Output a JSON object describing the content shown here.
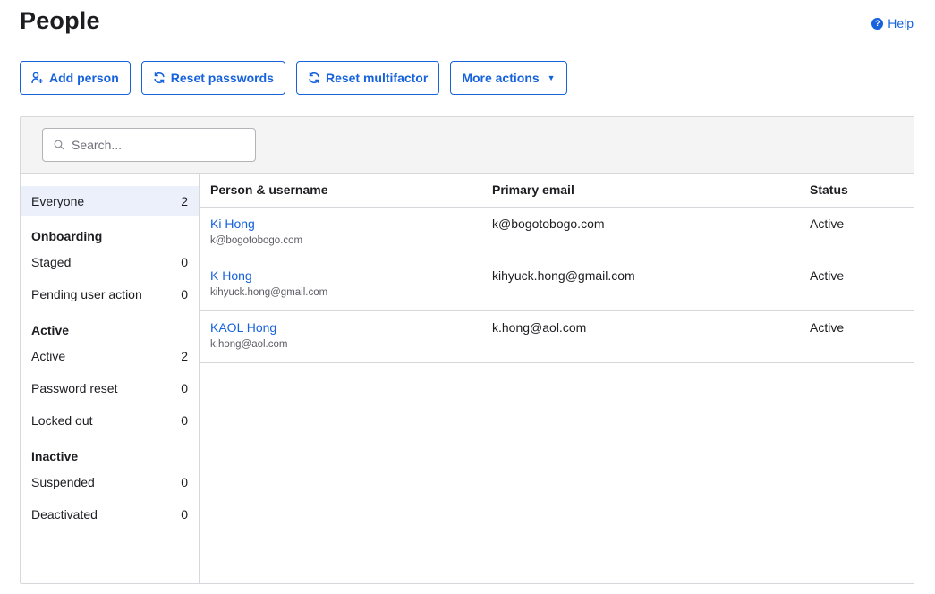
{
  "header": {
    "title": "People",
    "help_label": "Help"
  },
  "toolbar": {
    "add_person": "Add person",
    "reset_passwords": "Reset passwords",
    "reset_multifactor": "Reset multifactor",
    "more_actions": "More actions"
  },
  "search": {
    "placeholder": "Search..."
  },
  "sidebar": {
    "everyone": {
      "label": "Everyone",
      "count": "2"
    },
    "groups": [
      {
        "heading": "Onboarding",
        "items": [
          {
            "label": "Staged",
            "count": "0"
          },
          {
            "label": "Pending user action",
            "count": "0"
          }
        ]
      },
      {
        "heading": "Active",
        "items": [
          {
            "label": "Active",
            "count": "2"
          },
          {
            "label": "Password reset",
            "count": "0"
          },
          {
            "label": "Locked out",
            "count": "0"
          }
        ]
      },
      {
        "heading": "Inactive",
        "items": [
          {
            "label": "Suspended",
            "count": "0"
          },
          {
            "label": "Deactivated",
            "count": "0"
          }
        ]
      }
    ]
  },
  "table": {
    "columns": [
      "Person & username",
      "Primary email",
      "Status"
    ],
    "rows": [
      {
        "name": "Ki Hong",
        "username": "k@bogotobogo.com",
        "email": "k@bogotobogo.com",
        "status": "Active"
      },
      {
        "name": "K Hong",
        "username": "kihyuck.hong@gmail.com",
        "email": "kihyuck.hong@gmail.com",
        "status": "Active"
      },
      {
        "name": "KAOL Hong",
        "username": "k.hong@aol.com",
        "email": "k.hong@aol.com",
        "status": "Active"
      }
    ]
  },
  "colors": {
    "accent": "#1662dd",
    "selected_bg": "#ebf0fb",
    "border": "#d7d7dc"
  }
}
